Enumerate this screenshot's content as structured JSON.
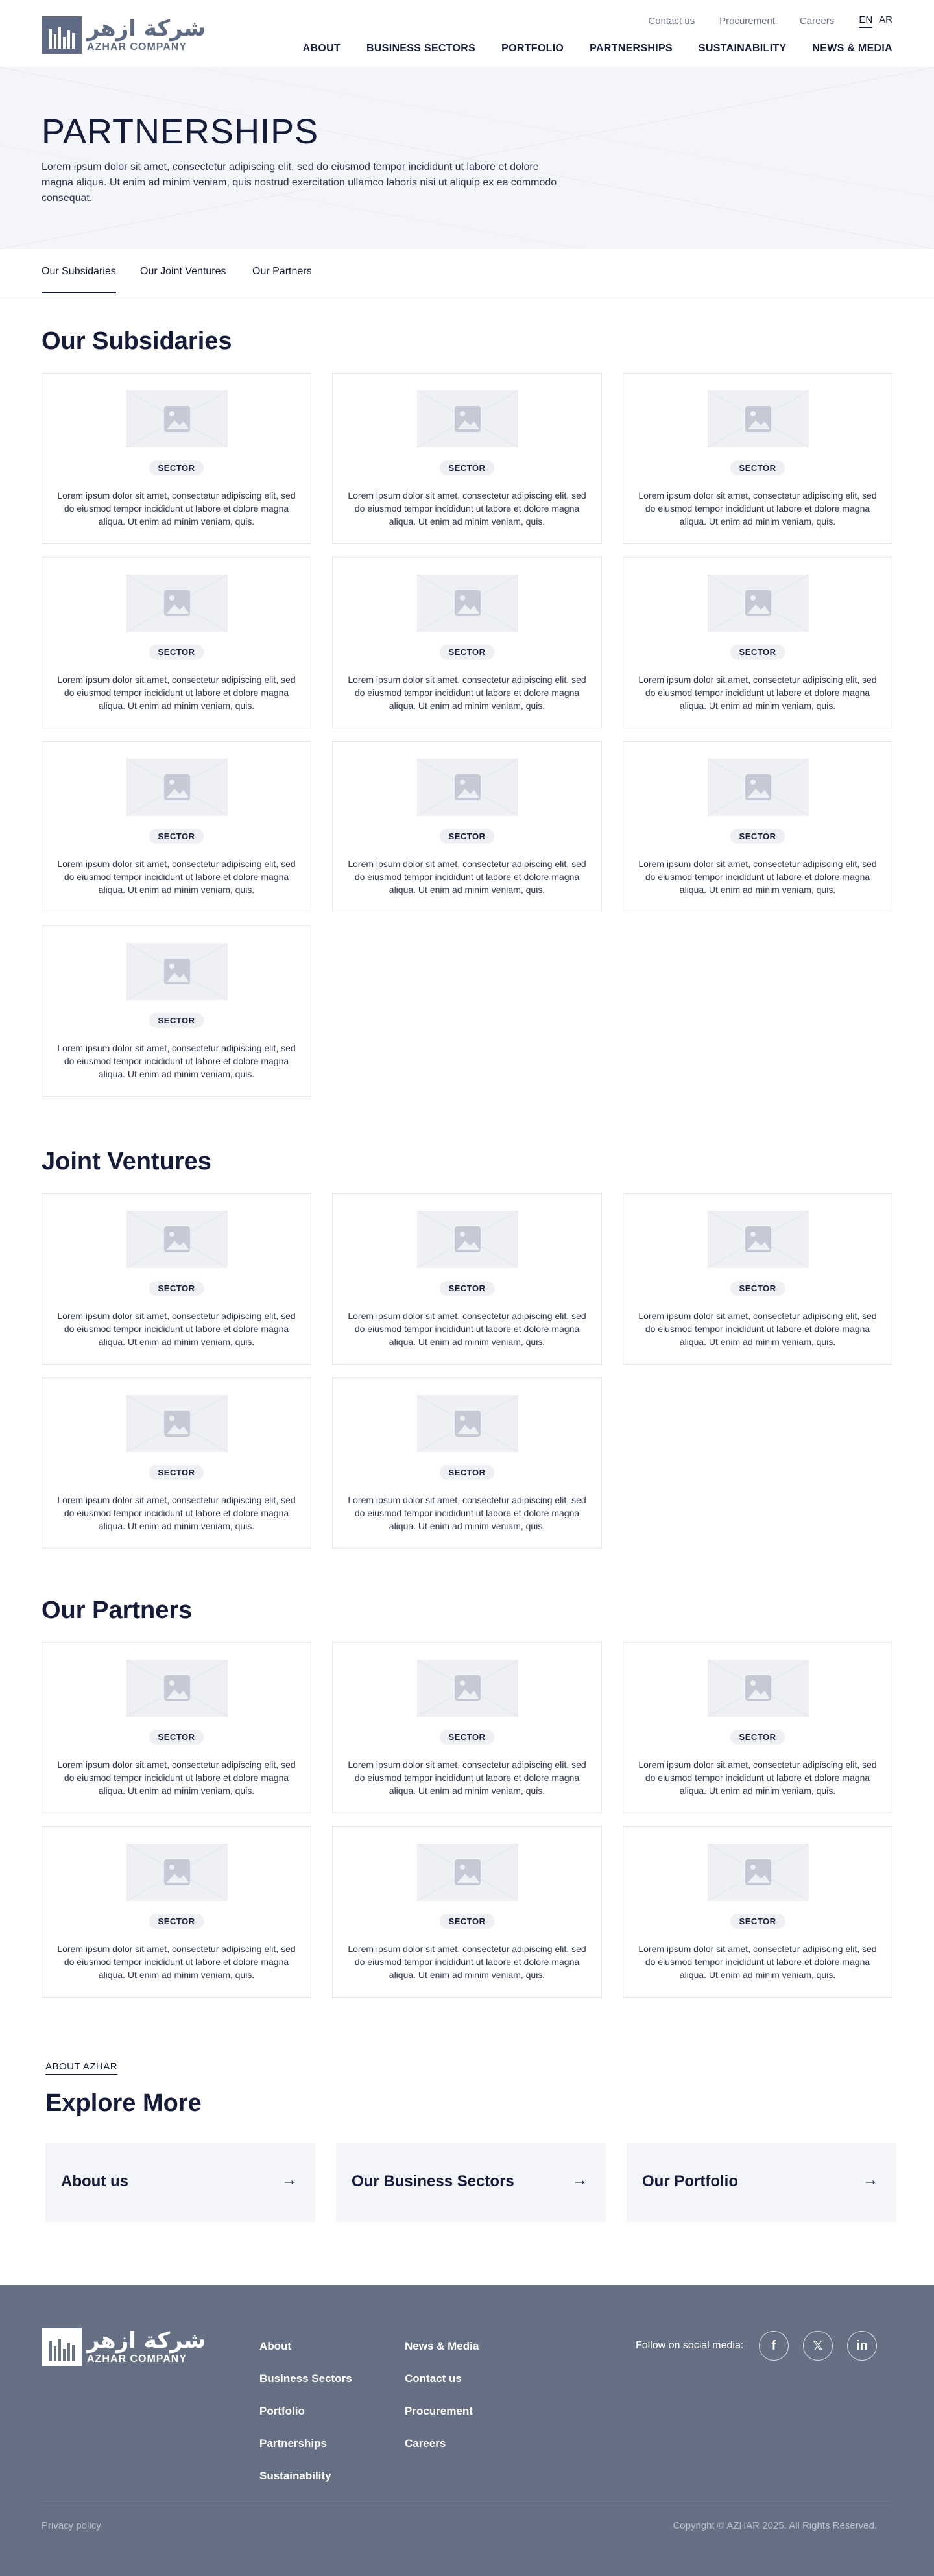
{
  "header": {
    "logo_ar": "شركة ازهر",
    "logo_en": "AZHAR COMPANY",
    "top_links": [
      "Contact us",
      "Procurement",
      "Careers"
    ],
    "lang_en": "EN",
    "lang_ar": "AR",
    "nav": [
      "ABOUT",
      "BUSINESS SECTORS",
      "PORTFOLIO",
      "PARTNERSHIPS",
      "SUSTAINABILITY",
      "NEWS & MEDIA"
    ]
  },
  "hero": {
    "title": "PARTNERSHIPS",
    "text": "Lorem ipsum dolor sit amet, consectetur adipiscing elit, sed do eiusmod tempor incididunt ut labore et dolore magna aliqua. Ut enim ad minim veniam, quis nostrud exercitation ullamco laboris nisi ut aliquip ex ea commodo consequat."
  },
  "tabs": [
    "Our Subsidaries",
    "Our Joint Ventures",
    "Our Partners"
  ],
  "sections": {
    "subsidiaries": {
      "title": "Our Subsidaries",
      "cards": [
        {
          "badge": "SECTOR",
          "text": "Lorem ipsum dolor sit amet, consectetur adipiscing elit, sed do eiusmod tempor incididunt ut labore et dolore magna aliqua. Ut enim ad minim veniam, quis."
        },
        {
          "badge": "SECTOR",
          "text": "Lorem ipsum dolor sit amet, consectetur adipiscing elit, sed do eiusmod tempor incididunt ut labore et dolore magna aliqua. Ut enim ad minim veniam, quis."
        },
        {
          "badge": "SECTOR",
          "text": "Lorem ipsum dolor sit amet, consectetur adipiscing elit, sed do eiusmod tempor incididunt ut labore et dolore magna aliqua. Ut enim ad minim veniam, quis."
        },
        {
          "badge": "SECTOR",
          "text": "Lorem ipsum dolor sit amet, consectetur adipiscing elit, sed do eiusmod tempor incididunt ut labore et dolore magna aliqua. Ut enim ad minim veniam, quis."
        },
        {
          "badge": "SECTOR",
          "text": "Lorem ipsum dolor sit amet, consectetur adipiscing elit, sed do eiusmod tempor incididunt ut labore et dolore magna aliqua. Ut enim ad minim veniam, quis."
        },
        {
          "badge": "SECTOR",
          "text": "Lorem ipsum dolor sit amet, consectetur adipiscing elit, sed do eiusmod tempor incididunt ut labore et dolore magna aliqua. Ut enim ad minim veniam, quis."
        },
        {
          "badge": "SECTOR",
          "text": "Lorem ipsum dolor sit amet, consectetur adipiscing elit, sed do eiusmod tempor incididunt ut labore et dolore magna aliqua. Ut enim ad minim veniam, quis."
        },
        {
          "badge": "SECTOR",
          "text": "Lorem ipsum dolor sit amet, consectetur adipiscing elit, sed do eiusmod tempor incididunt ut labore et dolore magna aliqua. Ut enim ad minim veniam, quis."
        },
        {
          "badge": "SECTOR",
          "text": "Lorem ipsum dolor sit amet, consectetur adipiscing elit, sed do eiusmod tempor incididunt ut labore et dolore magna aliqua. Ut enim ad minim veniam, quis."
        },
        {
          "badge": "SECTOR",
          "text": "Lorem ipsum dolor sit amet, consectetur adipiscing elit, sed do eiusmod tempor incididunt ut labore et dolore magna aliqua. Ut enim ad minim veniam, quis."
        }
      ]
    },
    "joint_ventures": {
      "title": "Joint Ventures",
      "cards": [
        {
          "badge": "SECTOR",
          "text": "Lorem ipsum dolor sit amet, consectetur adipiscing elit, sed do eiusmod tempor incididunt ut labore et dolore magna aliqua. Ut enim ad minim veniam, quis."
        },
        {
          "badge": "SECTOR",
          "text": "Lorem ipsum dolor sit amet, consectetur adipiscing elit, sed do eiusmod tempor incididunt ut labore et dolore magna aliqua. Ut enim ad minim veniam, quis."
        },
        {
          "badge": "SECTOR",
          "text": "Lorem ipsum dolor sit amet, consectetur adipiscing elit, sed do eiusmod tempor incididunt ut labore et dolore magna aliqua. Ut enim ad minim veniam, quis."
        },
        {
          "badge": "SECTOR",
          "text": "Lorem ipsum dolor sit amet, consectetur adipiscing elit, sed do eiusmod tempor incididunt ut labore et dolore magna aliqua. Ut enim ad minim veniam, quis."
        },
        {
          "badge": "SECTOR",
          "text": "Lorem ipsum dolor sit amet, consectetur adipiscing elit, sed do eiusmod tempor incididunt ut labore et dolore magna aliqua. Ut enim ad minim veniam, quis."
        }
      ]
    },
    "partners": {
      "title": "Our Partners",
      "cards": [
        {
          "badge": "SECTOR",
          "text": "Lorem ipsum dolor sit amet, consectetur adipiscing elit, sed do eiusmod tempor incididunt ut labore et dolore magna aliqua. Ut enim ad minim veniam, quis."
        },
        {
          "badge": "SECTOR",
          "text": "Lorem ipsum dolor sit amet, consectetur adipiscing elit, sed do eiusmod tempor incididunt ut labore et dolore magna aliqua. Ut enim ad minim veniam, quis."
        },
        {
          "badge": "SECTOR",
          "text": "Lorem ipsum dolor sit amet, consectetur adipiscing elit, sed do eiusmod tempor incididunt ut labore et dolore magna aliqua. Ut enim ad minim veniam, quis."
        },
        {
          "badge": "SECTOR",
          "text": "Lorem ipsum dolor sit amet, consectetur adipiscing elit, sed do eiusmod tempor incididunt ut labore et dolore magna aliqua. Ut enim ad minim veniam, quis."
        },
        {
          "badge": "SECTOR",
          "text": "Lorem ipsum dolor sit amet, consectetur adipiscing elit, sed do eiusmod tempor incididunt ut labore et dolore magna aliqua. Ut enim ad minim veniam, quis."
        },
        {
          "badge": "SECTOR",
          "text": "Lorem ipsum dolor sit amet, consectetur adipiscing elit, sed do eiusmod tempor incididunt ut labore et dolore magna aliqua. Ut enim ad minim veniam, quis."
        }
      ]
    }
  },
  "explore": {
    "tag": "ABOUT AZHAR",
    "title": "Explore More",
    "cards": [
      "About us",
      "Our Business Sectors",
      "Our Portfolio"
    ],
    "arrow": "→"
  },
  "footer": {
    "col1": [
      "About",
      "Business Sectors",
      "Portfolio",
      "Partnerships",
      "Sustainability"
    ],
    "col2": [
      "News & Media",
      "Contact us",
      "Procurement",
      "Careers"
    ],
    "follow": "Follow on social media:",
    "social": [
      {
        "icon": "facebook-icon",
        "glyph": "f"
      },
      {
        "icon": "x-icon",
        "glyph": "𝕏"
      },
      {
        "icon": "linkedin-icon",
        "glyph": "in"
      }
    ],
    "privacy": "Privacy policy",
    "copyright": "Copyright © AZHAR 2025. All Rights Reserved."
  }
}
